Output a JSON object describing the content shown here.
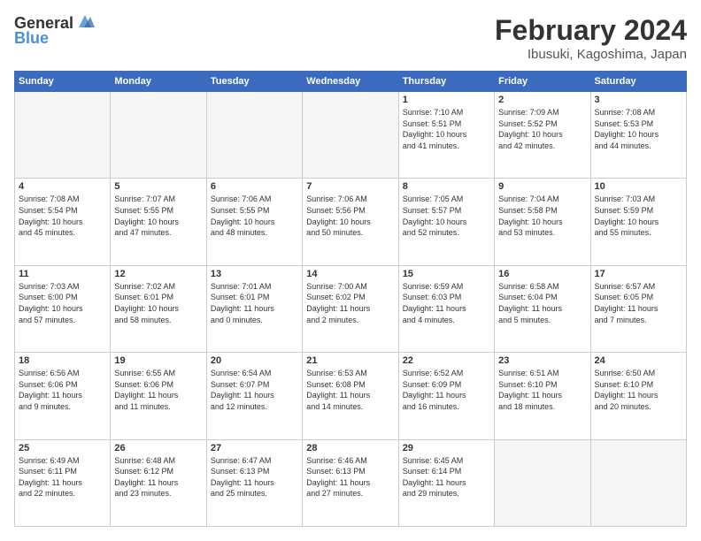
{
  "logo": {
    "line1": "General",
    "line2": "Blue"
  },
  "title": "February 2024",
  "subtitle": "Ibusuki, Kagoshima, Japan",
  "headers": [
    "Sunday",
    "Monday",
    "Tuesday",
    "Wednesday",
    "Thursday",
    "Friday",
    "Saturday"
  ],
  "weeks": [
    [
      {
        "day": "",
        "info": ""
      },
      {
        "day": "",
        "info": ""
      },
      {
        "day": "",
        "info": ""
      },
      {
        "day": "",
        "info": ""
      },
      {
        "day": "1",
        "info": "Sunrise: 7:10 AM\nSunset: 5:51 PM\nDaylight: 10 hours\nand 41 minutes."
      },
      {
        "day": "2",
        "info": "Sunrise: 7:09 AM\nSunset: 5:52 PM\nDaylight: 10 hours\nand 42 minutes."
      },
      {
        "day": "3",
        "info": "Sunrise: 7:08 AM\nSunset: 5:53 PM\nDaylight: 10 hours\nand 44 minutes."
      }
    ],
    [
      {
        "day": "4",
        "info": "Sunrise: 7:08 AM\nSunset: 5:54 PM\nDaylight: 10 hours\nand 45 minutes."
      },
      {
        "day": "5",
        "info": "Sunrise: 7:07 AM\nSunset: 5:55 PM\nDaylight: 10 hours\nand 47 minutes."
      },
      {
        "day": "6",
        "info": "Sunrise: 7:06 AM\nSunset: 5:55 PM\nDaylight: 10 hours\nand 48 minutes."
      },
      {
        "day": "7",
        "info": "Sunrise: 7:06 AM\nSunset: 5:56 PM\nDaylight: 10 hours\nand 50 minutes."
      },
      {
        "day": "8",
        "info": "Sunrise: 7:05 AM\nSunset: 5:57 PM\nDaylight: 10 hours\nand 52 minutes."
      },
      {
        "day": "9",
        "info": "Sunrise: 7:04 AM\nSunset: 5:58 PM\nDaylight: 10 hours\nand 53 minutes."
      },
      {
        "day": "10",
        "info": "Sunrise: 7:03 AM\nSunset: 5:59 PM\nDaylight: 10 hours\nand 55 minutes."
      }
    ],
    [
      {
        "day": "11",
        "info": "Sunrise: 7:03 AM\nSunset: 6:00 PM\nDaylight: 10 hours\nand 57 minutes."
      },
      {
        "day": "12",
        "info": "Sunrise: 7:02 AM\nSunset: 6:01 PM\nDaylight: 10 hours\nand 58 minutes."
      },
      {
        "day": "13",
        "info": "Sunrise: 7:01 AM\nSunset: 6:01 PM\nDaylight: 11 hours\nand 0 minutes."
      },
      {
        "day": "14",
        "info": "Sunrise: 7:00 AM\nSunset: 6:02 PM\nDaylight: 11 hours\nand 2 minutes."
      },
      {
        "day": "15",
        "info": "Sunrise: 6:59 AM\nSunset: 6:03 PM\nDaylight: 11 hours\nand 4 minutes."
      },
      {
        "day": "16",
        "info": "Sunrise: 6:58 AM\nSunset: 6:04 PM\nDaylight: 11 hours\nand 5 minutes."
      },
      {
        "day": "17",
        "info": "Sunrise: 6:57 AM\nSunset: 6:05 PM\nDaylight: 11 hours\nand 7 minutes."
      }
    ],
    [
      {
        "day": "18",
        "info": "Sunrise: 6:56 AM\nSunset: 6:06 PM\nDaylight: 11 hours\nand 9 minutes."
      },
      {
        "day": "19",
        "info": "Sunrise: 6:55 AM\nSunset: 6:06 PM\nDaylight: 11 hours\nand 11 minutes."
      },
      {
        "day": "20",
        "info": "Sunrise: 6:54 AM\nSunset: 6:07 PM\nDaylight: 11 hours\nand 12 minutes."
      },
      {
        "day": "21",
        "info": "Sunrise: 6:53 AM\nSunset: 6:08 PM\nDaylight: 11 hours\nand 14 minutes."
      },
      {
        "day": "22",
        "info": "Sunrise: 6:52 AM\nSunset: 6:09 PM\nDaylight: 11 hours\nand 16 minutes."
      },
      {
        "day": "23",
        "info": "Sunrise: 6:51 AM\nSunset: 6:10 PM\nDaylight: 11 hours\nand 18 minutes."
      },
      {
        "day": "24",
        "info": "Sunrise: 6:50 AM\nSunset: 6:10 PM\nDaylight: 11 hours\nand 20 minutes."
      }
    ],
    [
      {
        "day": "25",
        "info": "Sunrise: 6:49 AM\nSunset: 6:11 PM\nDaylight: 11 hours\nand 22 minutes."
      },
      {
        "day": "26",
        "info": "Sunrise: 6:48 AM\nSunset: 6:12 PM\nDaylight: 11 hours\nand 23 minutes."
      },
      {
        "day": "27",
        "info": "Sunrise: 6:47 AM\nSunset: 6:13 PM\nDaylight: 11 hours\nand 25 minutes."
      },
      {
        "day": "28",
        "info": "Sunrise: 6:46 AM\nSunset: 6:13 PM\nDaylight: 11 hours\nand 27 minutes."
      },
      {
        "day": "29",
        "info": "Sunrise: 6:45 AM\nSunset: 6:14 PM\nDaylight: 11 hours\nand 29 minutes."
      },
      {
        "day": "",
        "info": ""
      },
      {
        "day": "",
        "info": ""
      }
    ]
  ]
}
